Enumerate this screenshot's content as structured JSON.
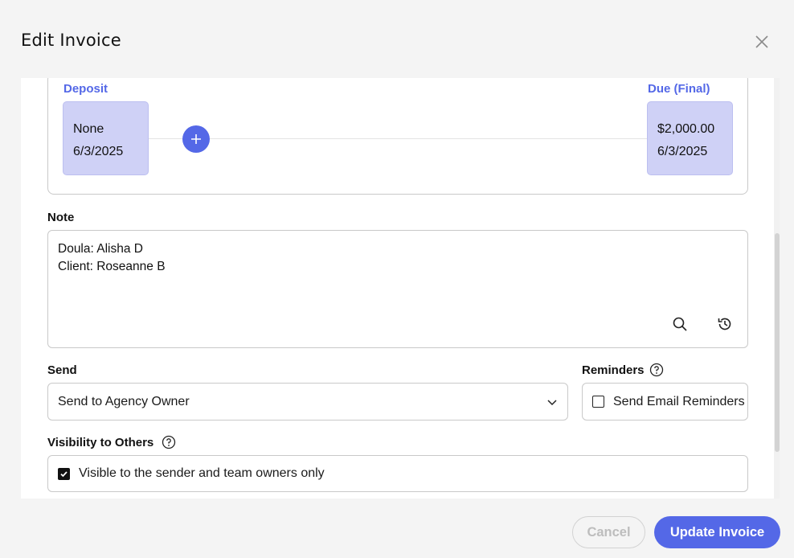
{
  "modal": {
    "title": "Edit Invoice"
  },
  "payments": {
    "deposit": {
      "label": "Deposit",
      "amount": "None",
      "date": "6/3/2025"
    },
    "final": {
      "label": "Due (Final)",
      "amount": "$2,000.00",
      "date": "6/3/2025"
    }
  },
  "note": {
    "label": "Note",
    "lines": [
      "Doula: Alisha D",
      "Client: Roseanne B"
    ]
  },
  "send": {
    "label": "Send",
    "selected": "Send to Agency Owner"
  },
  "reminders": {
    "label": "Reminders",
    "checkbox_label": "Send Email Reminders",
    "checked": false
  },
  "visibility": {
    "label": "Visibility to Others",
    "checkbox_label": "Visible to the sender and team owners only",
    "checked": true
  },
  "footer": {
    "cancel_label": "Cancel",
    "update_label": "Update Invoice"
  },
  "colors": {
    "accent": "#5468e7",
    "card_bg": "#cfd1f6"
  },
  "icons": [
    "close-icon",
    "plus-icon",
    "search-icon",
    "history-icon",
    "chevron-down-icon",
    "help-icon",
    "checkmark-icon"
  ]
}
